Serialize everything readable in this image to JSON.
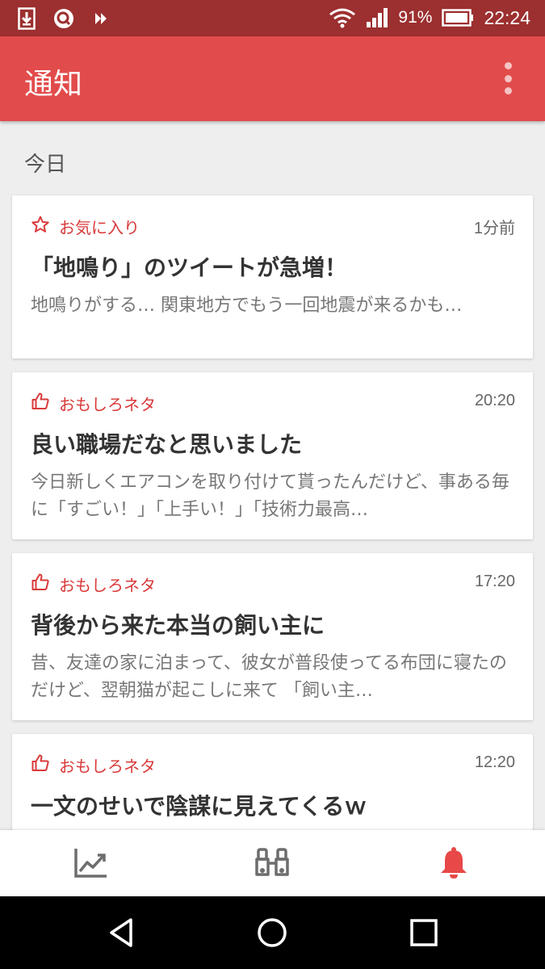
{
  "status_bar": {
    "battery_percent": "91%",
    "time": "22:24",
    "icons": [
      "download-icon",
      "search-app-icon",
      "app-logo-icon",
      "wifi-icon",
      "signal-icon",
      "battery-icon"
    ]
  },
  "app_bar": {
    "title": "通知",
    "more_icon": "more-vertical-icon"
  },
  "section": {
    "label": "今日"
  },
  "notifications": [
    {
      "category": "お気に入り",
      "category_icon": "star-icon",
      "time": "1分前",
      "headline": "「地鳴り」のツイートが急増！",
      "snippet": "地鳴りがする… 関東地方でもう一回地震が来るかも…"
    },
    {
      "category": "おもしろネタ",
      "category_icon": "thumbs-up-icon",
      "time": "20:20",
      "headline": "良い職場だなと思いました",
      "snippet": "今日新しくエアコンを取り付けて貰ったんだけど、事ある毎に「すごい！」「上手い！」「技術力最高…"
    },
    {
      "category": "おもしろネタ",
      "category_icon": "thumbs-up-icon",
      "time": "17:20",
      "headline": "背後から来た本当の飼い主に",
      "snippet": "昔、友達の家に泊まって、彼女が普段使ってる布団に寝たのだけど、翌朝猫が起こしに来て 「飼い主…"
    },
    {
      "category": "おもしろネタ",
      "category_icon": "thumbs-up-icon",
      "time": "12:20",
      "headline": "一文のせいで陰謀に見えてくるｗ",
      "snippet": ""
    }
  ],
  "bottom_nav": {
    "items": [
      "trending-icon",
      "binoculars-icon",
      "bell-icon"
    ],
    "active": "bell-icon",
    "colors": {
      "inactive": "#6d6d6d",
      "active": "#e84848"
    }
  },
  "system_nav": [
    "back-icon",
    "home-icon",
    "recents-icon"
  ],
  "colors": {
    "accent": "#e24b4b",
    "status_bar": "#9c2f2f",
    "category_text": "#d93a3a"
  }
}
